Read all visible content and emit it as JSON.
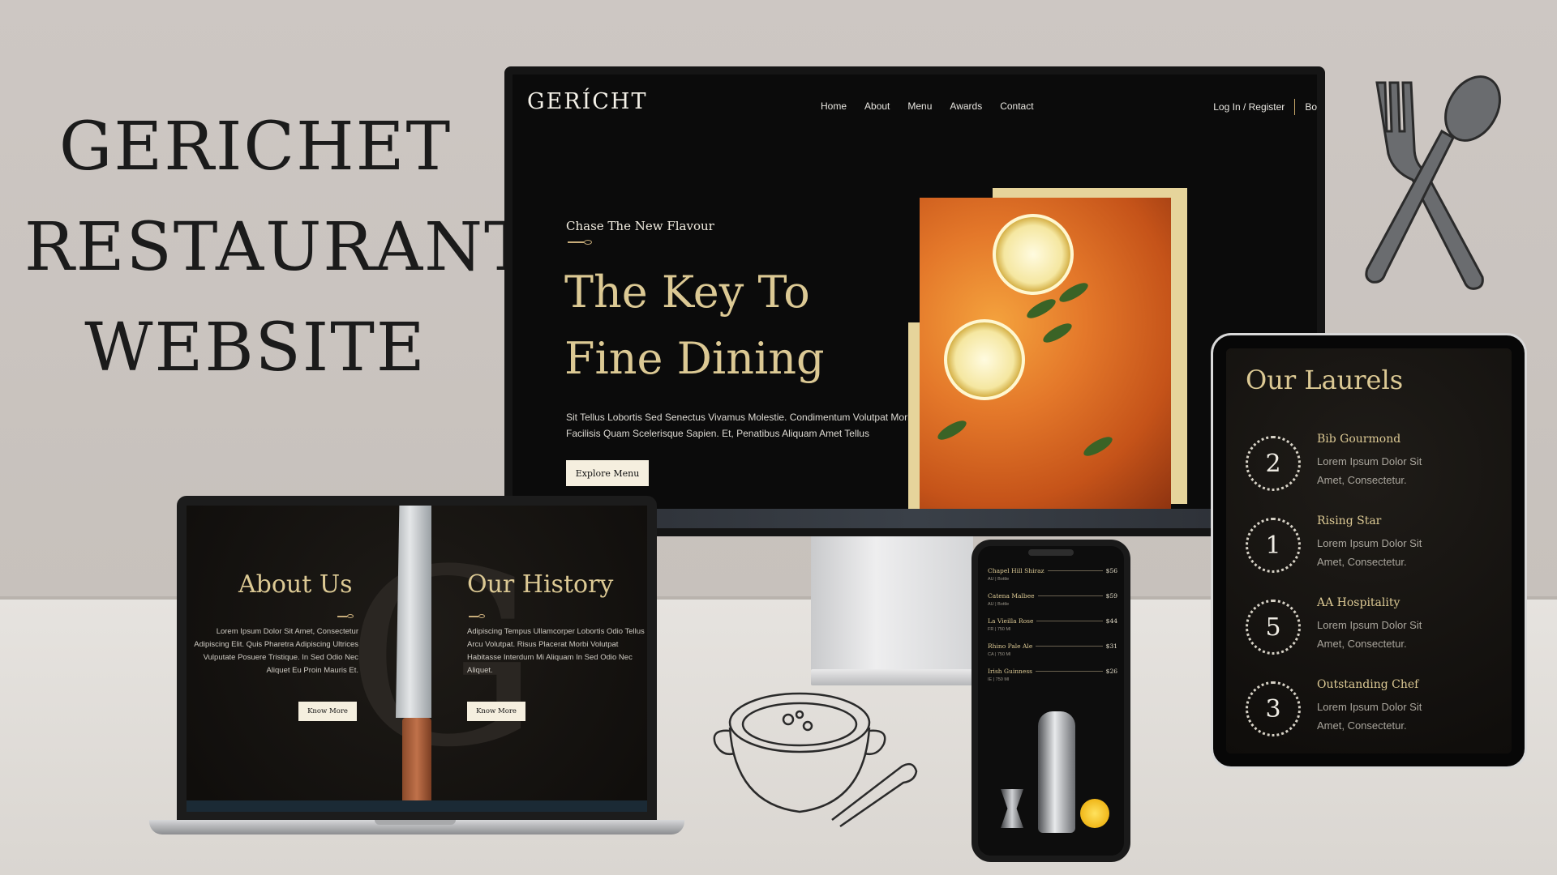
{
  "headline": {
    "line1": "GERICHET",
    "line2": "RESTAURANT",
    "line3": "WEBSITE"
  },
  "desktop": {
    "logo": "GERÍCHT",
    "nav": [
      "Home",
      "About",
      "Menu",
      "Awards",
      "Contact"
    ],
    "login": "Log In / Register",
    "book": "Bo",
    "hero_subtitle": "Chase The New Flavour",
    "hero_title": "The Key To Fine Dining",
    "hero_desc": "Sit Tellus Lobortis Sed Senectus Vivamus Molestie. Condimentum Volutpat Morbi Facilisis Quam Scelerisque Sapien. Et, Penatibus Aliquam Amet Tellus",
    "hero_button": "Explore Menu"
  },
  "laptop": {
    "about_title": "About Us",
    "about_text": "Lorem Ipsum Dolor Sit Amet, Consectetur Adipiscing Elit. Quis Pharetra Adipiscing Ultrices Vulputate Posuere Tristique. In Sed Odio Nec Aliquet Eu Proin Mauris Et.",
    "about_button": "Know More",
    "history_title": "Our History",
    "history_text": "Adipiscing Tempus Ullamcorper Lobortis Odio Tellus Arcu Volutpat. Risus Placerat Morbi Volutpat Habitasse Interdum Mi Aliquam In Sed Odio Nec Aliquet.",
    "history_button": "Know More"
  },
  "phone": {
    "menu": [
      {
        "name": "Chapel Hill Shiraz",
        "price": "$56",
        "sub": "AU | Bottle"
      },
      {
        "name": "Catena Malbee",
        "price": "$59",
        "sub": "AU | Bottle"
      },
      {
        "name": "La Vieilla Rose",
        "price": "$44",
        "sub": "FR | 750 Ml"
      },
      {
        "name": "Rhino Pale Ale",
        "price": "$31",
        "sub": "CA | 750 Ml"
      },
      {
        "name": "Irish Guinness",
        "price": "$26",
        "sub": "IE | 750 Ml"
      }
    ]
  },
  "tablet": {
    "title": "Our Laurels",
    "laurels": [
      {
        "number": "2",
        "name": "Bib Gourmond",
        "desc": "Lorem Ipsum Dolor Sit Amet, Consectetur."
      },
      {
        "number": "1",
        "name": "Rising Star",
        "desc": "Lorem Ipsum Dolor Sit Amet, Consectetur."
      },
      {
        "number": "5",
        "name": "AA Hospitality",
        "desc": "Lorem Ipsum Dolor Sit Amet, Consectetur."
      },
      {
        "number": "3",
        "name": "Outstanding Chef",
        "desc": "Lorem Ipsum Dolor Sit Amet, Consectetur."
      }
    ]
  },
  "colors": {
    "gold": "#dcc994",
    "dark": "#0b0b0b",
    "cream": "#f5efdf",
    "wall": "#cbc5c0"
  }
}
